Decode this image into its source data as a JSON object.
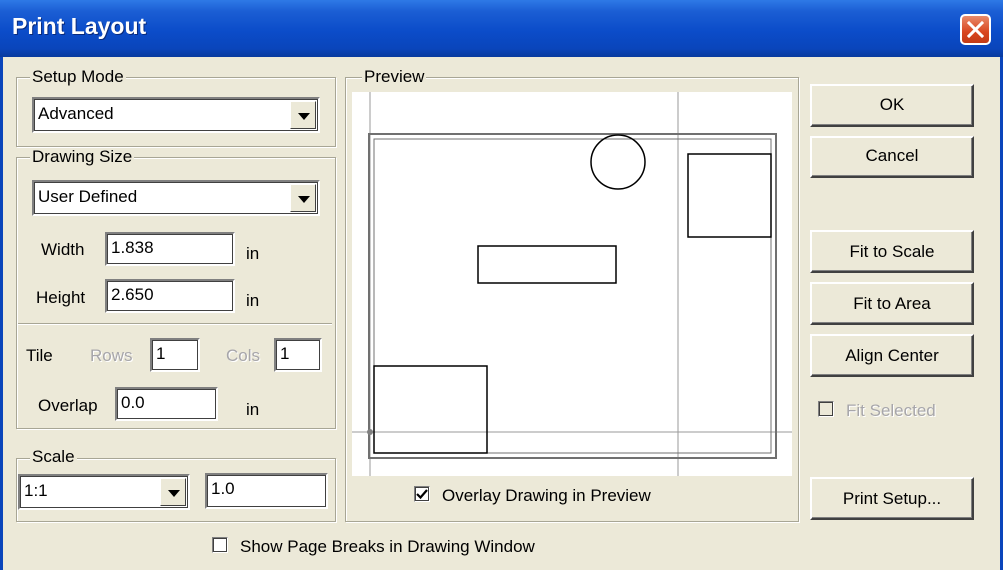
{
  "window": {
    "title": "Print Layout",
    "close_icon": "close-icon"
  },
  "setup_mode": {
    "label": "Setup Mode",
    "value": "Advanced"
  },
  "drawing_size": {
    "label": "Drawing Size",
    "value": "User Defined",
    "width_label": "Width",
    "width_value": "1.838",
    "height_label": "Height",
    "height_value": "2.650",
    "unit": "in"
  },
  "tile": {
    "label": "Tile",
    "rows_label": "Rows",
    "rows_value": "1",
    "cols_label": "Cols",
    "cols_value": "1",
    "overlap_label": "Overlap",
    "overlap_value": "0.0",
    "unit": "in"
  },
  "scale": {
    "label": "Scale",
    "preset": "1:1",
    "value": "1.0"
  },
  "preview": {
    "label": "Preview",
    "overlay_label": "Overlay Drawing in Preview",
    "overlay_checked": true
  },
  "buttons": {
    "ok": "OK",
    "cancel": "Cancel",
    "fit_to_scale": "Fit to Scale",
    "fit_to_area": "Fit to Area",
    "align_center": "Align Center",
    "print_setup": "Print Setup..."
  },
  "fit_selected": {
    "label": "Fit Selected",
    "checked": false,
    "enabled": false
  },
  "page_breaks": {
    "label": "Show Page Breaks in Drawing Window",
    "checked": false
  }
}
